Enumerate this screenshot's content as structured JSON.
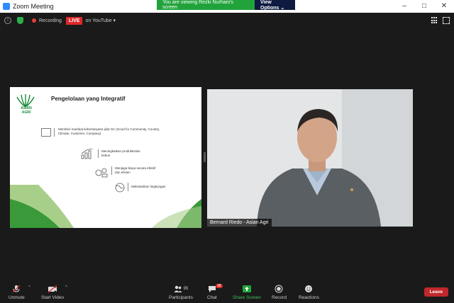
{
  "window": {
    "title": "Zoom Meeting",
    "minimize": "–",
    "maximize": "□",
    "close": "✕"
  },
  "share_banner": {
    "viewing_text": "You are viewing Rezki Nurhani's screen",
    "view_options_label": "View Options ⌄"
  },
  "topbar": {
    "recording_label": "Recording",
    "live_label": "LIVE",
    "live_on_label": "on YouTube ▾"
  },
  "slide": {
    "logo_text": "ASIAN AGRI",
    "title": "Pengelolaan yang Integratif",
    "items": [
      {
        "text": "Memberi manfaat keberlanjutan pilar 5C (Good for Community, Country, Climate, Customer, Company)"
      },
      {
        "text": "Meningkatkan produktivitas kebun"
      },
      {
        "text": "Menjaga biaya secara efektif dan efisien"
      },
      {
        "text": "Melestarikan lingkungan"
      }
    ]
  },
  "video": {
    "participant_name": "Bernard Riedo - Asian Agri"
  },
  "toolbar": {
    "unmute": "Unmute",
    "start_video": "Start Video",
    "participants": "Participants",
    "participants_count": "95",
    "chat": "Chat",
    "chat_badge": "38",
    "share_screen": "Share Screen",
    "record": "Record",
    "reactions": "Reactions",
    "leave": "Leave"
  },
  "colors": {
    "zoom_blue": "#2d8cff",
    "banner_green": "#21a33b",
    "live_red": "#e02828",
    "slide_green": "#1a8a3a",
    "leave_red": "#c0282b"
  }
}
